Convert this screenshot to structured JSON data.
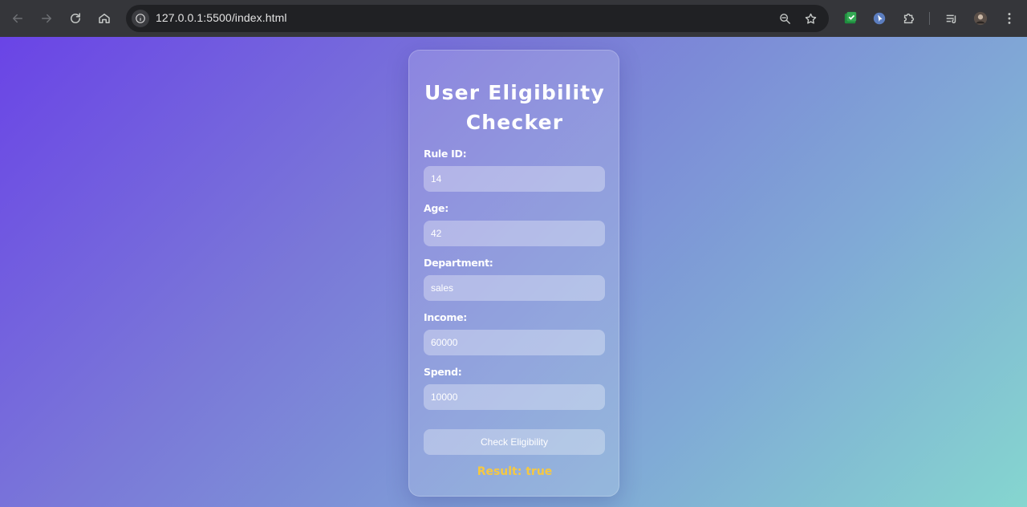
{
  "browser": {
    "url": "127.0.0.1:5500/index.html",
    "icons": {
      "back": "arrow-left-icon",
      "forward": "arrow-right-icon",
      "reload": "reload-icon",
      "home": "home-icon",
      "info": "info-icon",
      "zoom": "zoom-out-icon",
      "bookmark": "star-icon",
      "extensions": "puzzle-icon",
      "reading_list": "reading-list-icon",
      "menu": "kebab-menu-icon"
    }
  },
  "form": {
    "title": "User Eligibility Checker",
    "fields": [
      {
        "label": "Rule ID:",
        "value": "14"
      },
      {
        "label": "Age:",
        "value": "42"
      },
      {
        "label": "Department:",
        "value": "sales"
      },
      {
        "label": "Income:",
        "value": "60000"
      },
      {
        "label": "Spend:",
        "value": "10000"
      }
    ],
    "button_label": "Check Eligibility",
    "result": "Result: true"
  },
  "colors": {
    "result_text": "#f5c842",
    "gradient_start": "#6a44e6",
    "gradient_end": "#85d6cf"
  }
}
